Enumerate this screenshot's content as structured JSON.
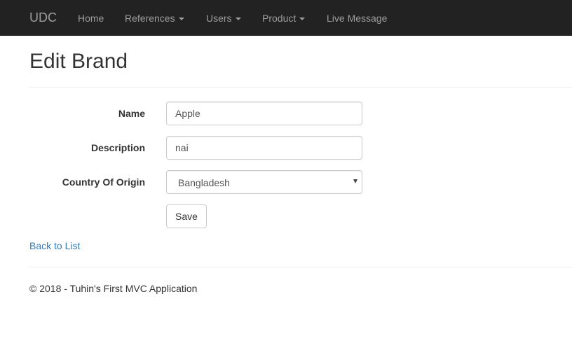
{
  "navbar": {
    "brand": "UDC",
    "items": [
      {
        "label": "Home",
        "dropdown": false
      },
      {
        "label": "References",
        "dropdown": true
      },
      {
        "label": "Users",
        "dropdown": true
      },
      {
        "label": "Product",
        "dropdown": true
      },
      {
        "label": "Live Message",
        "dropdown": false
      }
    ]
  },
  "page": {
    "title": "Edit Brand"
  },
  "form": {
    "name_label": "Name",
    "name_value": "Apple",
    "description_label": "Description",
    "description_value": "nai",
    "country_label": "Country Of Origin",
    "country_value": "Bangladesh",
    "save_label": "Save"
  },
  "links": {
    "back_to_list": "Back to List"
  },
  "footer": {
    "text": "© 2018 - Tuhin's First MVC Application"
  },
  "colors": {
    "navbar_bg": "#222222",
    "nav_text": "#9d9d9d",
    "link": "#337ab7"
  }
}
